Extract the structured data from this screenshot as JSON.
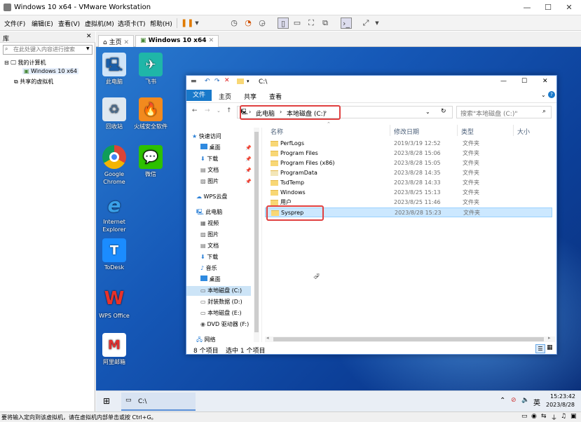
{
  "window": {
    "title": "Windows 10 x64 - VMware Workstation"
  },
  "menu": [
    "文件(F)",
    "编辑(E)",
    "查看(V)",
    "虚拟机(M)",
    "选项卡(T)",
    "帮助(H)"
  ],
  "library": {
    "header": "库",
    "search_placeholder": "在此处键入内容进行搜索",
    "tree": [
      "我的计算机",
      "Windows 10 x64",
      "共享的虚拟机"
    ]
  },
  "tabs": [
    "主页",
    "Windows 10 x64"
  ],
  "desktop_icons": [
    "此电脑",
    "飞书",
    "回收站",
    "火绒安全软件",
    "Google Chrome",
    "微信",
    "Internet Explorer",
    "ToDesk",
    "WPS Office",
    "阿里邮箱"
  ],
  "explorer": {
    "title": "C:\\",
    "ribbon_tabs": [
      "文件",
      "主页",
      "共享",
      "查看"
    ],
    "breadcrumb": [
      "此电脑",
      "本地磁盘 (C:)"
    ],
    "search_placeholder": "搜索\"本地磁盘 (C:)\"",
    "nav": [
      "快速访问",
      "桌面",
      "下载",
      "文档",
      "图片",
      "WPS云盘",
      "此电脑",
      "视频",
      "图片",
      "文档",
      "下载",
      "音乐",
      "桌面",
      "本地磁盘 (C:)",
      "封装数据 (D:)",
      "本地磁盘 (E:)",
      "DVD 驱动器 (F:)",
      "网络"
    ],
    "columns": [
      "名称",
      "修改日期",
      "类型",
      "大小"
    ],
    "files": [
      {
        "name": "PerfLogs",
        "date": "2019/3/19 12:52",
        "type": "文件夹"
      },
      {
        "name": "Program Files",
        "date": "2023/8/28 15:06",
        "type": "文件夹"
      },
      {
        "name": "Program Files (x86)",
        "date": "2023/8/28 15:05",
        "type": "文件夹"
      },
      {
        "name": "ProgramData",
        "date": "2023/8/28 14:35",
        "type": "文件夹"
      },
      {
        "name": "TsdTemp",
        "date": "2023/8/28 14:33",
        "type": "文件夹"
      },
      {
        "name": "Windows",
        "date": "2023/8/25 15:13",
        "type": "文件夹"
      },
      {
        "name": "用户",
        "date": "2023/8/25 11:46",
        "type": "文件夹"
      },
      {
        "name": "Sysprep",
        "date": "2023/8/28 15:23",
        "type": "文件夹"
      }
    ],
    "status_count": "8 个项目",
    "status_selected": "选中 1 个项目"
  },
  "taskbar": {
    "app_label": "C:\\",
    "ime": "英",
    "time": "15:23:42",
    "date": "2023/8/28"
  },
  "statusbar": "要将输入定向到该虚拟机，请在虚拟机内部单击或按 Ctrl+G。"
}
